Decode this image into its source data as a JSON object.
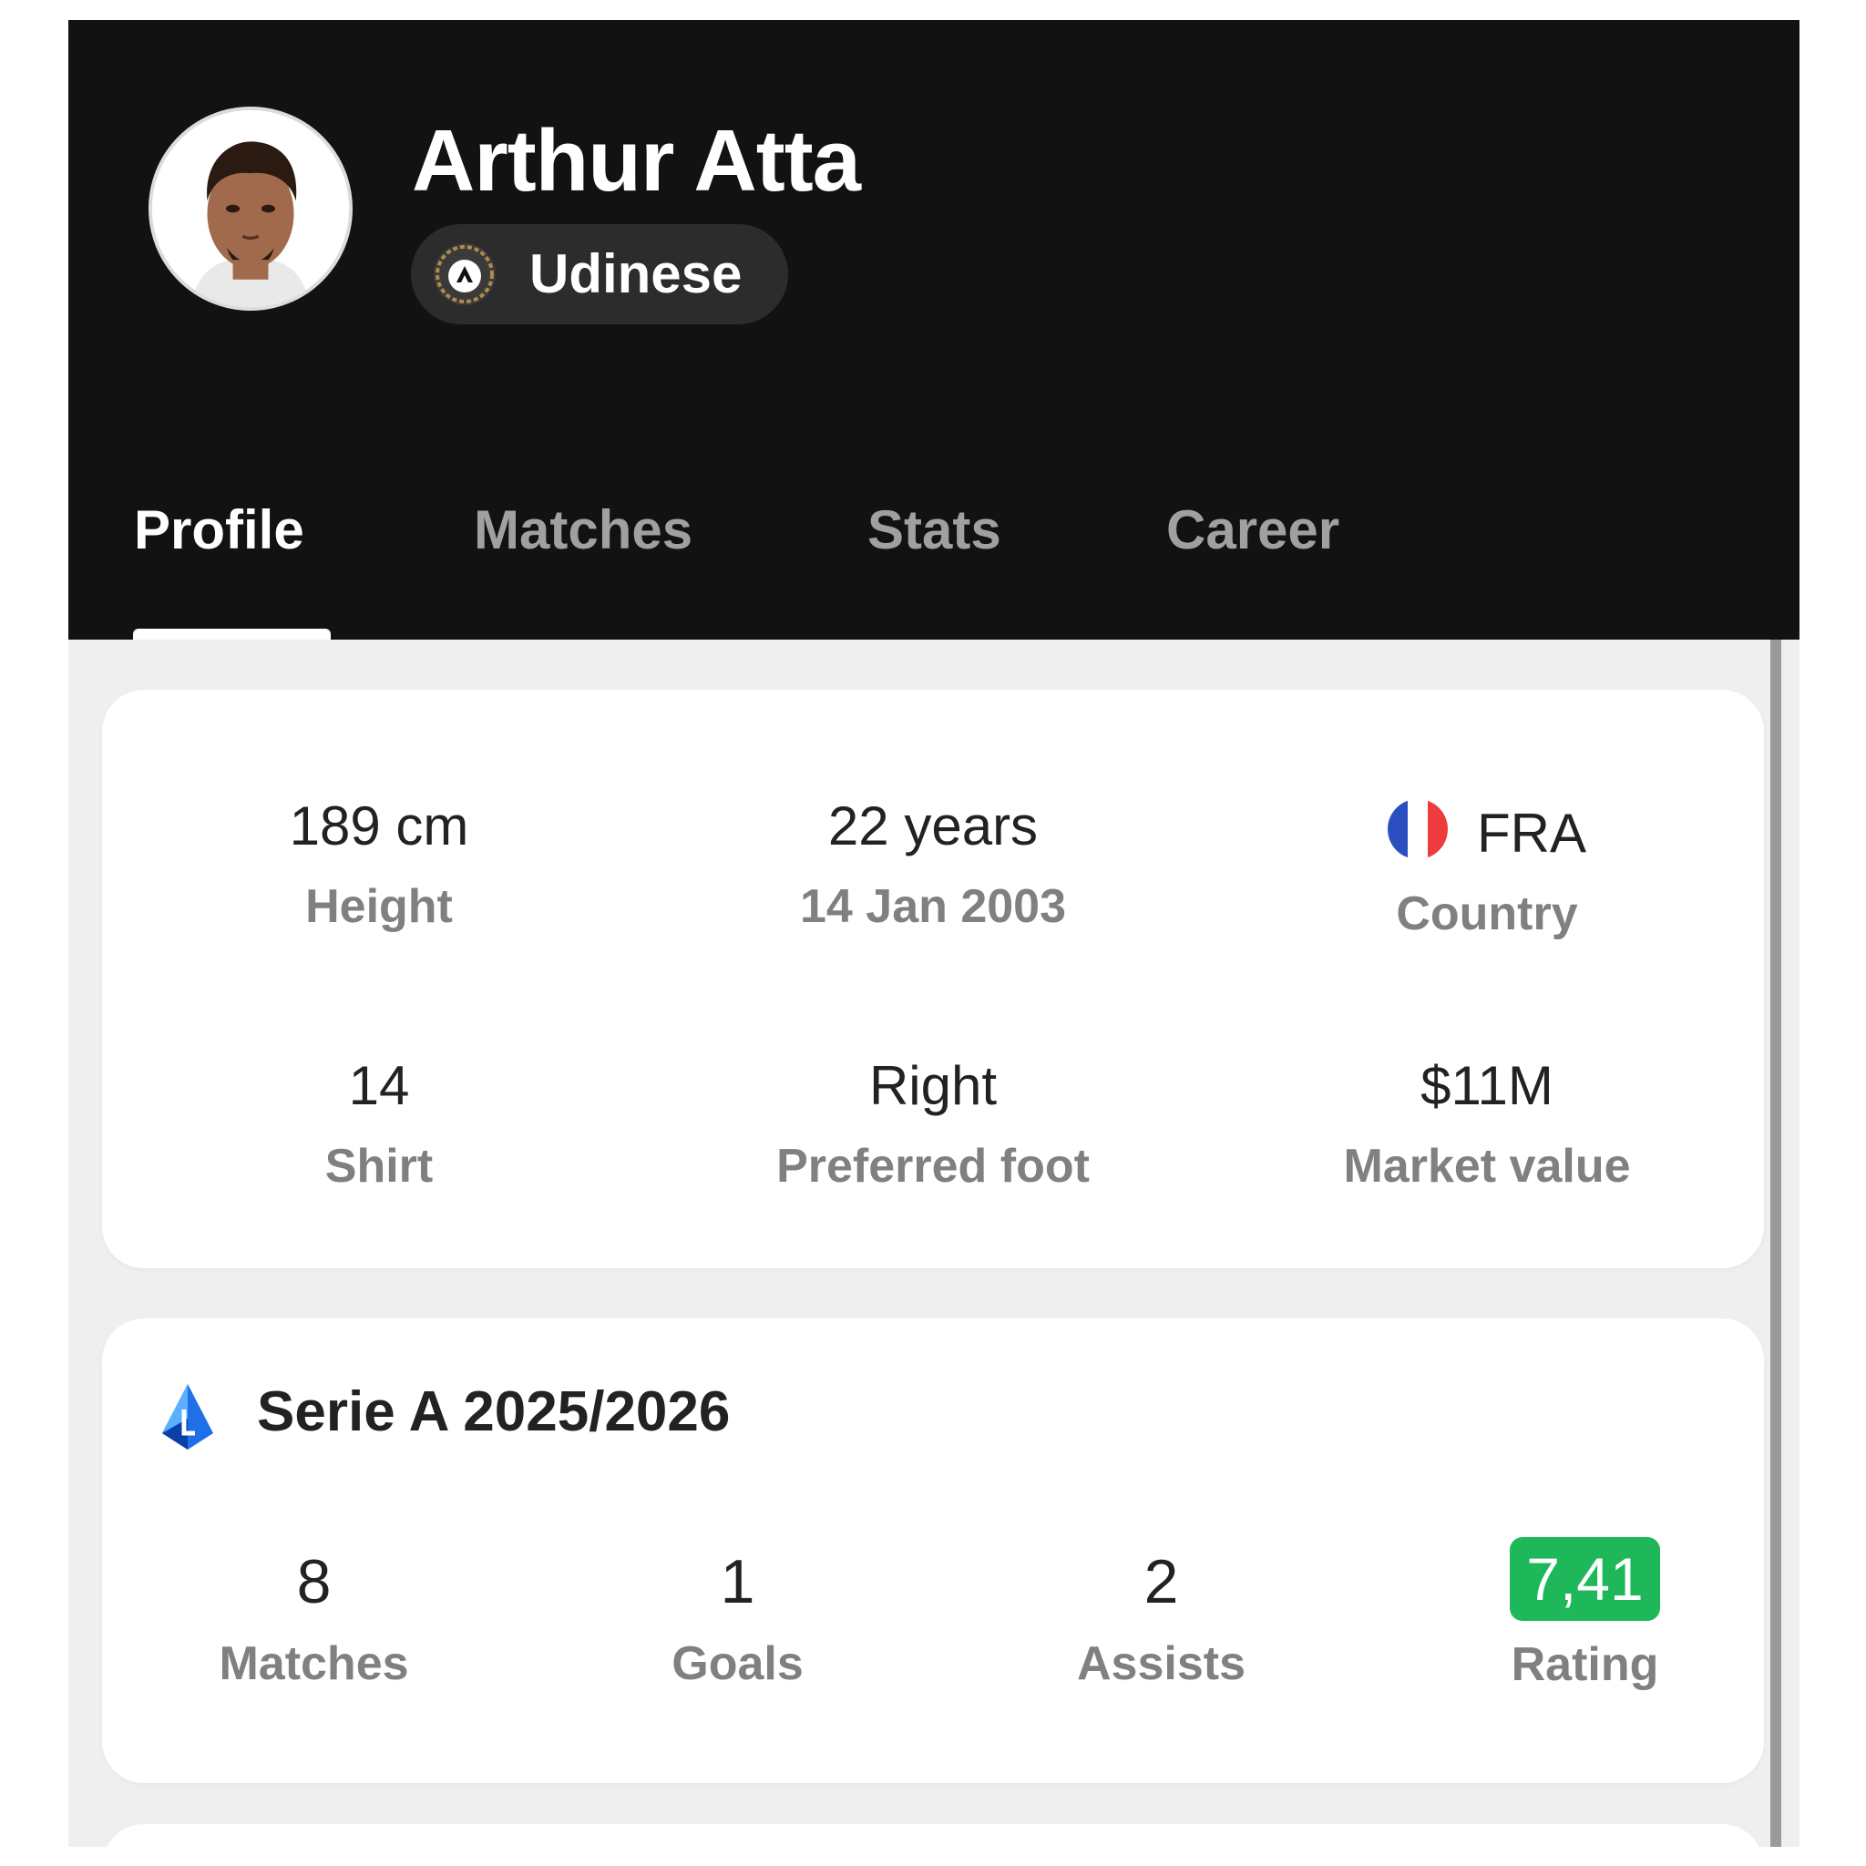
{
  "player": {
    "name": "Arthur Atta",
    "team": "Udinese"
  },
  "tabs": [
    "Profile",
    "Matches",
    "Stats",
    "Career"
  ],
  "active_tab": "Profile",
  "info": {
    "height": {
      "value": "189 cm",
      "label": "Height"
    },
    "age": {
      "value": "22 years",
      "label": "14 Jan 2003"
    },
    "country": {
      "value": "FRA",
      "label": "Country"
    },
    "shirt": {
      "value": "14",
      "label": "Shirt"
    },
    "foot": {
      "value": "Right",
      "label": "Preferred foot"
    },
    "market": {
      "value": "$11M",
      "label": "Market value"
    }
  },
  "season": {
    "title": "Serie A 2025/2026",
    "matches": {
      "value": "8",
      "label": "Matches"
    },
    "goals": {
      "value": "1",
      "label": "Goals"
    },
    "assists": {
      "value": "2",
      "label": "Assists"
    },
    "rating": {
      "value": "7,41",
      "label": "Rating"
    }
  },
  "colors": {
    "header_bg": "#121212",
    "page_bg": "#efefef",
    "rating_green": "#1eb85a",
    "label_gray": "#808080"
  },
  "icons": {
    "avatar": "player-photo",
    "team_logo": "udinese-crest-icon",
    "country_flag": "france-flag-icon",
    "league": "serie-a-logo-icon"
  }
}
